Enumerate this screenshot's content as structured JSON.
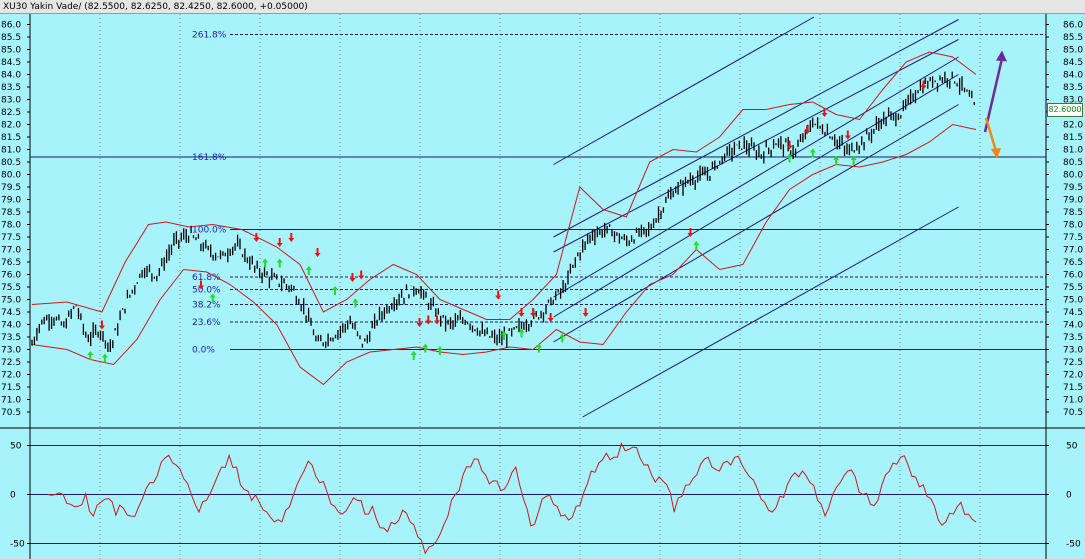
{
  "title": {
    "symbol": "XU30 Yakin Vade/",
    "quote": "(82.5500, 82.6250, 82.4250, 82.6000, +0.05000)"
  },
  "last_price_label": "82.6000",
  "colors": {
    "background": "#a6f3fb",
    "candle": "#000000",
    "bollinger": "#cc1a1a",
    "channel": "#1a1a80",
    "fibonacci": "#2020c0",
    "oscillator": "#cc1a1a",
    "buy_arrow": "#22dd22",
    "sell_arrow": "#ee1111",
    "up_forecast_arrow": "#6a2a9a",
    "down_forecast_arrow": "#ee8a10"
  },
  "chart_data": [
    {
      "type": "candlestick",
      "title": "",
      "ylim": [
        70.5,
        86.0
      ],
      "y_ticks": [
        "86.0",
        "85.5",
        "85.0",
        "84.5",
        "84.0",
        "83.5",
        "83.0",
        "82.5",
        "82.0",
        "81.5",
        "81.0",
        "80.5",
        "80.0",
        "79.5",
        "79.0",
        "78.5",
        "78.0",
        "77.5",
        "77.0",
        "76.5",
        "76.0",
        "75.5",
        "75.0",
        "74.5",
        "74.0",
        "73.5",
        "73.0",
        "72.5",
        "72.0",
        "71.5",
        "71.0",
        "70.5"
      ],
      "close_path": [
        [
          0,
          73.2
        ],
        [
          0.015,
          74.1
        ],
        [
          0.035,
          74.3
        ],
        [
          0.055,
          73.9
        ],
        [
          0.075,
          74.8
        ],
        [
          0.095,
          73.4
        ],
        [
          0.115,
          73.8
        ],
        [
          0.135,
          73.1
        ],
        [
          0.16,
          74.8
        ],
        [
          0.19,
          76.2
        ],
        [
          0.215,
          76.0
        ],
        [
          0.245,
          77.3
        ],
        [
          0.27,
          77.6
        ],
        [
          0.3,
          77.0
        ],
        [
          0.325,
          76.7
        ],
        [
          0.35,
          77.2
        ],
        [
          0.385,
          76.2
        ],
        [
          0.415,
          75.8
        ],
        [
          0.445,
          75.5
        ],
        [
          0.47,
          74.5
        ],
        [
          0.49,
          73.2
        ],
        [
          0.52,
          73.6
        ],
        [
          0.545,
          74.1
        ],
        [
          0.57,
          73.2
        ],
        [
          0.595,
          74.3
        ],
        [
          0.625,
          75.0
        ],
        [
          0.66,
          75.5
        ],
        [
          0.69,
          74.6
        ],
        [
          0.715,
          74.0
        ],
        [
          0.745,
          74.2
        ],
        [
          0.775,
          73.6
        ],
        [
          0.8,
          73.4
        ],
        [
          0.82,
          73.6
        ],
        [
          0.845,
          74.0
        ],
        [
          0.87,
          74.4
        ],
        [
          0.895,
          75.0
        ],
        [
          0.915,
          75.5
        ],
        [
          0.935,
          76.7
        ],
        [
          0.96,
          77.6
        ],
        [
          0.99,
          77.8
        ],
        [
          1.02,
          77.3
        ],
        [
          1.04,
          77.6
        ],
        [
          1.06,
          77.8
        ],
        [
          1.08,
          78.6
        ],
        [
          1.1,
          79.3
        ],
        [
          1.13,
          79.8
        ],
        [
          1.16,
          80.0
        ],
        [
          1.19,
          80.8
        ],
        [
          1.22,
          81.2
        ],
        [
          1.25,
          80.8
        ],
        [
          1.28,
          81.3
        ],
        [
          1.31,
          80.9
        ],
        [
          1.34,
          82.1
        ],
        [
          1.37,
          81.6
        ],
        [
          1.4,
          80.9
        ],
        [
          1.43,
          81.4
        ],
        [
          1.46,
          82.2
        ],
        [
          1.49,
          82.4
        ],
        [
          1.52,
          83.4
        ],
        [
          1.55,
          83.8
        ],
        [
          1.58,
          83.9
        ],
        [
          1.6,
          83.4
        ],
        [
          1.62,
          82.6
        ]
      ],
      "bollinger_upper": [
        [
          0,
          74.8
        ],
        [
          0.06,
          74.9
        ],
        [
          0.12,
          74.5
        ],
        [
          0.16,
          76.5
        ],
        [
          0.2,
          78.0
        ],
        [
          0.23,
          78.1
        ],
        [
          0.27,
          77.9
        ],
        [
          0.31,
          78.0
        ],
        [
          0.36,
          77.8
        ],
        [
          0.42,
          77.1
        ],
        [
          0.46,
          76.4
        ],
        [
          0.5,
          74.5
        ],
        [
          0.54,
          75.0
        ],
        [
          0.58,
          75.8
        ],
        [
          0.62,
          76.4
        ],
        [
          0.66,
          76.0
        ],
        [
          0.7,
          75.0
        ],
        [
          0.74,
          74.6
        ],
        [
          0.78,
          74.2
        ],
        [
          0.82,
          74.2
        ],
        [
          0.86,
          75.0
        ],
        [
          0.9,
          76.0
        ],
        [
          0.94,
          79.5
        ],
        [
          0.98,
          78.6
        ],
        [
          1.02,
          78.3
        ],
        [
          1.06,
          80.5
        ],
        [
          1.1,
          81.0
        ],
        [
          1.14,
          80.9
        ],
        [
          1.18,
          81.5
        ],
        [
          1.22,
          82.6
        ],
        [
          1.26,
          82.6
        ],
        [
          1.3,
          82.8
        ],
        [
          1.34,
          82.9
        ],
        [
          1.38,
          82.4
        ],
        [
          1.42,
          82.2
        ],
        [
          1.46,
          83.4
        ],
        [
          1.5,
          84.5
        ],
        [
          1.54,
          84.9
        ],
        [
          1.58,
          84.7
        ],
        [
          1.62,
          84.0
        ]
      ],
      "bollinger_lower": [
        [
          0,
          73.2
        ],
        [
          0.06,
          73.0
        ],
        [
          0.1,
          72.6
        ],
        [
          0.14,
          72.4
        ],
        [
          0.18,
          73.4
        ],
        [
          0.22,
          75.0
        ],
        [
          0.26,
          76.2
        ],
        [
          0.3,
          76.1
        ],
        [
          0.34,
          75.6
        ],
        [
          0.38,
          74.9
        ],
        [
          0.42,
          74.0
        ],
        [
          0.46,
          72.3
        ],
        [
          0.5,
          71.6
        ],
        [
          0.54,
          72.5
        ],
        [
          0.58,
          72.9
        ],
        [
          0.62,
          73.0
        ],
        [
          0.66,
          73.1
        ],
        [
          0.7,
          72.9
        ],
        [
          0.74,
          72.8
        ],
        [
          0.78,
          72.9
        ],
        [
          0.82,
          73.1
        ],
        [
          0.86,
          73.0
        ],
        [
          0.9,
          73.8
        ],
        [
          0.94,
          73.3
        ],
        [
          0.98,
          73.2
        ],
        [
          1.02,
          74.5
        ],
        [
          1.06,
          75.6
        ],
        [
          1.1,
          76.0
        ],
        [
          1.14,
          77.0
        ],
        [
          1.18,
          76.2
        ],
        [
          1.22,
          76.4
        ],
        [
          1.26,
          78.1
        ],
        [
          1.3,
          79.4
        ],
        [
          1.34,
          80.0
        ],
        [
          1.38,
          80.4
        ],
        [
          1.42,
          80.3
        ],
        [
          1.46,
          80.5
        ],
        [
          1.5,
          80.8
        ],
        [
          1.54,
          81.3
        ],
        [
          1.58,
          82.0
        ],
        [
          1.62,
          81.8
        ]
      ],
      "channel_lines": [
        {
          "from": [
            0.895,
            80.4
          ],
          "to": [
            1.342,
            86.3
          ]
        },
        {
          "from": [
            0.895,
            77.5
          ],
          "to": [
            1.59,
            86.2
          ]
        },
        {
          "from": [
            0.895,
            76.9
          ],
          "to": [
            1.59,
            85.4
          ]
        },
        {
          "from": [
            0.895,
            75.1
          ],
          "to": [
            1.59,
            84.7
          ]
        },
        {
          "from": [
            0.895,
            74.3
          ],
          "to": [
            1.59,
            84.0
          ]
        },
        {
          "from": [
            0.895,
            73.3
          ],
          "to": [
            1.59,
            82.8
          ]
        },
        {
          "from": [
            0.945,
            70.3
          ],
          "to": [
            1.59,
            78.7
          ]
        }
      ],
      "horizontal_line": 80.7,
      "fibonacci": [
        {
          "label": "261.8%",
          "value": 85.6
        },
        {
          "label": "161.8%",
          "value": 80.7
        },
        {
          "label": "100.0%",
          "value": 77.8
        },
        {
          "label": "61.8%",
          "value": 75.9
        },
        {
          "label": "50.0%",
          "value": 75.4
        },
        {
          "label": "38.2%",
          "value": 74.8
        },
        {
          "label": "23.6%",
          "value": 74.1
        },
        {
          "label": "0.0%",
          "value": 73.0
        }
      ],
      "buy_signals": [
        [
          0.1,
          72.7
        ],
        [
          0.125,
          72.6
        ],
        [
          0.31,
          75.0
        ],
        [
          0.4,
          76.4
        ],
        [
          0.425,
          76.4
        ],
        [
          0.475,
          76.1
        ],
        [
          0.52,
          75.3
        ],
        [
          0.555,
          74.8
        ],
        [
          0.655,
          72.7
        ],
        [
          0.675,
          73.0
        ],
        [
          0.7,
          72.9
        ],
        [
          0.81,
          73.5
        ],
        [
          0.84,
          73.6
        ],
        [
          0.87,
          73.0
        ],
        [
          0.91,
          73.4
        ],
        [
          1.14,
          77.1
        ],
        [
          1.3,
          80.6
        ],
        [
          1.34,
          80.8
        ],
        [
          1.38,
          80.5
        ],
        [
          1.41,
          80.5
        ]
      ],
      "sell_signals": [
        [
          0.12,
          74.0
        ],
        [
          0.29,
          75.6
        ],
        [
          0.385,
          77.5
        ],
        [
          0.425,
          77.3
        ],
        [
          0.445,
          77.5
        ],
        [
          0.49,
          76.9
        ],
        [
          0.55,
          75.9
        ],
        [
          0.565,
          76.0
        ],
        [
          0.665,
          74.1
        ],
        [
          0.68,
          74.2
        ],
        [
          0.695,
          74.2
        ],
        [
          0.8,
          75.2
        ],
        [
          0.84,
          74.5
        ],
        [
          0.86,
          74.5
        ],
        [
          0.89,
          74.3
        ],
        [
          0.95,
          74.5
        ],
        [
          1.13,
          77.7
        ],
        [
          1.3,
          81.2
        ],
        [
          1.33,
          81.8
        ],
        [
          1.36,
          82.5
        ],
        [
          1.4,
          81.6
        ],
        [
          1.53,
          83.6
        ]
      ],
      "forecast": {
        "up_target": 84.8,
        "down_target": 80.7
      }
    },
    {
      "type": "line",
      "title": "",
      "ylim": [
        -65,
        60
      ],
      "y_ticks": [
        "50",
        "0",
        "-50"
      ],
      "values": [
        0,
        0,
        0,
        -10,
        -12,
        1,
        -22,
        -8,
        -4,
        -21,
        -14,
        -22,
        -13,
        6,
        12,
        33,
        40,
        30,
        16,
        0,
        -18,
        -6,
        10,
        28,
        40,
        28,
        5,
        -6,
        -8,
        -18,
        -28,
        -28,
        -13,
        10,
        25,
        30,
        12,
        2,
        -12,
        -20,
        -10,
        -6,
        -20,
        -12,
        -34,
        -38,
        -30,
        -16,
        -28,
        -43,
        -60,
        -52,
        -40,
        -22,
        0,
        20,
        28,
        36,
        20,
        14,
        4,
        12,
        28,
        -4,
        -32,
        -18,
        -2,
        -10,
        -22,
        -26,
        -12,
        2,
        24,
        32,
        42,
        38,
        52,
        46,
        48,
        30,
        20,
        18,
        10,
        -18,
        -2,
        10,
        20,
        36,
        28,
        24,
        34,
        38,
        30,
        18,
        6,
        -8,
        -18,
        -2,
        10,
        22,
        24,
        12,
        -6,
        -22,
        0,
        12,
        24,
        18,
        0,
        -10,
        -6,
        20,
        32,
        38,
        30,
        18,
        10,
        -4,
        -26,
        -28,
        -20,
        -8,
        -20,
        -28
      ]
    }
  ]
}
